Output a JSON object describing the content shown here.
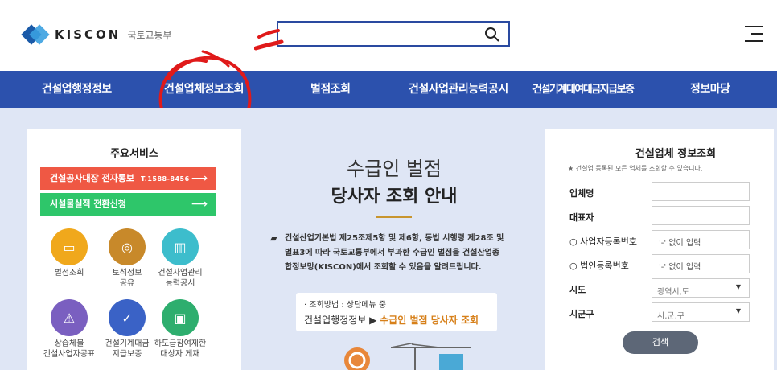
{
  "header": {
    "logo_text": "KISCON",
    "logo_sub": "국토교통부",
    "search_placeholder": "",
    "search_value": ""
  },
  "nav": {
    "items": [
      {
        "label": "건설업행정정보"
      },
      {
        "label": "건설업체정보조회"
      },
      {
        "label": "벌점조회"
      },
      {
        "label": "건설사업관리능력공시"
      },
      {
        "label": "건설기계대여대금지급보증"
      },
      {
        "label": "정보마당"
      }
    ]
  },
  "services": {
    "title": "주요서비스",
    "btn_red_label": "건설공사대장 전자통보",
    "btn_red_tel": "T.1588-8456",
    "btn_green_label": "시설물실적 전환신청",
    "arrow": "⟶",
    "icons": [
      {
        "label": "벌점조회",
        "color": "#f0a81c",
        "glyph": "▭"
      },
      {
        "label": "토석정보\n공유",
        "color": "#c8892a",
        "glyph": "◎"
      },
      {
        "label": "건설사업관리\n능력공시",
        "color": "#3dbdcc",
        "glyph": "▥"
      },
      {
        "label": "상습체불\n건설사업자공표",
        "color": "#7a5fc0",
        "glyph": "⚠"
      },
      {
        "label": "건설기계대금\n지급보증",
        "color": "#3a62c6",
        "glyph": "✓"
      },
      {
        "label": "하도급참여제한\n대상자 게재",
        "color": "#2eae6e",
        "glyph": "▣"
      }
    ]
  },
  "notice": {
    "title1": "수급인 벌점",
    "title2": "당사자 조회 안내",
    "bullet": "▰",
    "body": "건설산업기본법 제25조제5항 및 제6항, 동법 시행령 제28조 및 별표3에 따라 국토교통부에서 부과한 수급인 벌점을 건설산업종합정보망(KISCON)에서 조회할 수 있음을 알려드립니다.",
    "method_label": "· 조회방법 : 상단메뉴 중",
    "method_path": "건설업행정정보 ▶ ",
    "method_highlight": "수급인 벌점 당사자 조회"
  },
  "form": {
    "title": "건설업체 정보조회",
    "note": "★ 건설업 등록된 모든 업체를 조회할 수 있습니다.",
    "company_label": "업체명",
    "rep_label": "대표자",
    "bizno_label": "○ 사업자등록번호",
    "bizno_placeholder": "'-' 없이 입력",
    "corpno_label": "○ 법인등록번호",
    "corpno_placeholder": "'-' 없이 입력",
    "sido_label": "시도",
    "sido_value": "광역시,도",
    "sigungu_label": "시군구",
    "sigungu_value": "시,군,구",
    "caret": "▼",
    "search_btn": "검색"
  }
}
